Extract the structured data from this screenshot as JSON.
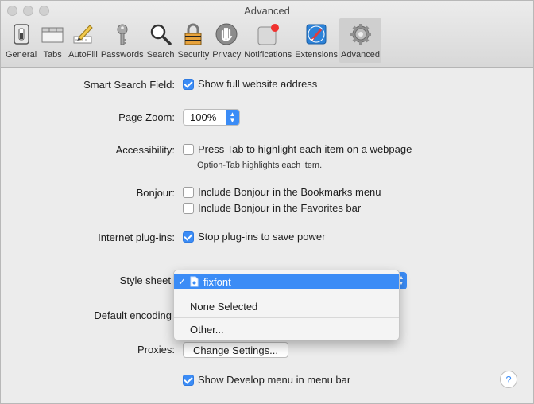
{
  "window": {
    "title": "Advanced"
  },
  "toolbar": {
    "tabs": [
      {
        "label": "General",
        "icon": "general-switch-icon"
      },
      {
        "label": "Tabs",
        "icon": "tabs-icon"
      },
      {
        "label": "AutoFill",
        "icon": "autofill-pencil-icon"
      },
      {
        "label": "Passwords",
        "icon": "key-icon"
      },
      {
        "label": "Search",
        "icon": "magnifier-icon"
      },
      {
        "label": "Security",
        "icon": "padlock-icon"
      },
      {
        "label": "Privacy",
        "icon": "hand-icon"
      },
      {
        "label": "Notifications",
        "icon": "notification-badge-icon"
      },
      {
        "label": "Extensions",
        "icon": "puzzle-icon"
      },
      {
        "label": "Advanced",
        "icon": "gear-icon",
        "active": true
      }
    ]
  },
  "settings": {
    "smart_search": {
      "label": "Smart Search Field:",
      "option": "Show full website address",
      "checked": true
    },
    "page_zoom": {
      "label": "Page Zoom:",
      "value": "100%"
    },
    "accessibility": {
      "label": "Accessibility:",
      "option": "Press Tab to highlight each item on a webpage",
      "checked": false,
      "hint": "Option-Tab highlights each item."
    },
    "bonjour": {
      "label": "Bonjour:",
      "options": [
        {
          "text": "Include Bonjour in the Bookmarks menu",
          "checked": false
        },
        {
          "text": "Include Bonjour in the Favorites bar",
          "checked": false
        }
      ]
    },
    "plugins": {
      "label": "Internet plug-ins:",
      "option": "Stop plug-ins to save power",
      "checked": true
    },
    "style_sheet": {
      "label": "Style sheet"
    },
    "default_encoding": {
      "label": "Default encoding"
    },
    "proxies": {
      "label": "Proxies:",
      "button": "Change Settings..."
    },
    "develop": {
      "option": "Show Develop menu in menu bar",
      "checked": true
    }
  },
  "style_menu": {
    "selected": "fixfont",
    "items": [
      "None Selected",
      "Other..."
    ]
  },
  "colors": {
    "accent": "#3b8cf6",
    "background": "#ececec"
  },
  "help_label": "?"
}
